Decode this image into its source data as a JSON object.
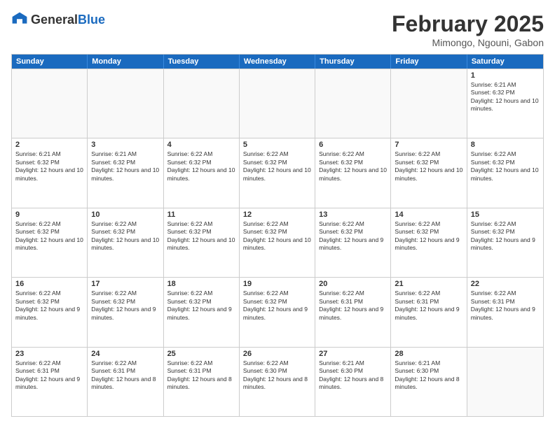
{
  "header": {
    "logo_general": "General",
    "logo_blue": "Blue",
    "month_title": "February 2025",
    "location": "Mimongo, Ngouni, Gabon"
  },
  "days_of_week": [
    "Sunday",
    "Monday",
    "Tuesday",
    "Wednesday",
    "Thursday",
    "Friday",
    "Saturday"
  ],
  "rows": [
    {
      "cells": [
        {
          "day": "",
          "empty": true
        },
        {
          "day": "",
          "empty": true
        },
        {
          "day": "",
          "empty": true
        },
        {
          "day": "",
          "empty": true
        },
        {
          "day": "",
          "empty": true
        },
        {
          "day": "",
          "empty": true
        },
        {
          "day": "1",
          "text": "Sunrise: 6:21 AM\nSunset: 6:32 PM\nDaylight: 12 hours and 10 minutes."
        }
      ]
    },
    {
      "cells": [
        {
          "day": "2",
          "text": "Sunrise: 6:21 AM\nSunset: 6:32 PM\nDaylight: 12 hours and 10 minutes."
        },
        {
          "day": "3",
          "text": "Sunrise: 6:21 AM\nSunset: 6:32 PM\nDaylight: 12 hours and 10 minutes."
        },
        {
          "day": "4",
          "text": "Sunrise: 6:22 AM\nSunset: 6:32 PM\nDaylight: 12 hours and 10 minutes."
        },
        {
          "day": "5",
          "text": "Sunrise: 6:22 AM\nSunset: 6:32 PM\nDaylight: 12 hours and 10 minutes."
        },
        {
          "day": "6",
          "text": "Sunrise: 6:22 AM\nSunset: 6:32 PM\nDaylight: 12 hours and 10 minutes."
        },
        {
          "day": "7",
          "text": "Sunrise: 6:22 AM\nSunset: 6:32 PM\nDaylight: 12 hours and 10 minutes."
        },
        {
          "day": "8",
          "text": "Sunrise: 6:22 AM\nSunset: 6:32 PM\nDaylight: 12 hours and 10 minutes."
        }
      ]
    },
    {
      "cells": [
        {
          "day": "9",
          "text": "Sunrise: 6:22 AM\nSunset: 6:32 PM\nDaylight: 12 hours and 10 minutes."
        },
        {
          "day": "10",
          "text": "Sunrise: 6:22 AM\nSunset: 6:32 PM\nDaylight: 12 hours and 10 minutes."
        },
        {
          "day": "11",
          "text": "Sunrise: 6:22 AM\nSunset: 6:32 PM\nDaylight: 12 hours and 10 minutes."
        },
        {
          "day": "12",
          "text": "Sunrise: 6:22 AM\nSunset: 6:32 PM\nDaylight: 12 hours and 10 minutes."
        },
        {
          "day": "13",
          "text": "Sunrise: 6:22 AM\nSunset: 6:32 PM\nDaylight: 12 hours and 9 minutes."
        },
        {
          "day": "14",
          "text": "Sunrise: 6:22 AM\nSunset: 6:32 PM\nDaylight: 12 hours and 9 minutes."
        },
        {
          "day": "15",
          "text": "Sunrise: 6:22 AM\nSunset: 6:32 PM\nDaylight: 12 hours and 9 minutes."
        }
      ]
    },
    {
      "cells": [
        {
          "day": "16",
          "text": "Sunrise: 6:22 AM\nSunset: 6:32 PM\nDaylight: 12 hours and 9 minutes."
        },
        {
          "day": "17",
          "text": "Sunrise: 6:22 AM\nSunset: 6:32 PM\nDaylight: 12 hours and 9 minutes."
        },
        {
          "day": "18",
          "text": "Sunrise: 6:22 AM\nSunset: 6:32 PM\nDaylight: 12 hours and 9 minutes."
        },
        {
          "day": "19",
          "text": "Sunrise: 6:22 AM\nSunset: 6:32 PM\nDaylight: 12 hours and 9 minutes."
        },
        {
          "day": "20",
          "text": "Sunrise: 6:22 AM\nSunset: 6:31 PM\nDaylight: 12 hours and 9 minutes."
        },
        {
          "day": "21",
          "text": "Sunrise: 6:22 AM\nSunset: 6:31 PM\nDaylight: 12 hours and 9 minutes."
        },
        {
          "day": "22",
          "text": "Sunrise: 6:22 AM\nSunset: 6:31 PM\nDaylight: 12 hours and 9 minutes."
        }
      ]
    },
    {
      "cells": [
        {
          "day": "23",
          "text": "Sunrise: 6:22 AM\nSunset: 6:31 PM\nDaylight: 12 hours and 9 minutes."
        },
        {
          "day": "24",
          "text": "Sunrise: 6:22 AM\nSunset: 6:31 PM\nDaylight: 12 hours and 8 minutes."
        },
        {
          "day": "25",
          "text": "Sunrise: 6:22 AM\nSunset: 6:31 PM\nDaylight: 12 hours and 8 minutes."
        },
        {
          "day": "26",
          "text": "Sunrise: 6:22 AM\nSunset: 6:30 PM\nDaylight: 12 hours and 8 minutes."
        },
        {
          "day": "27",
          "text": "Sunrise: 6:21 AM\nSunset: 6:30 PM\nDaylight: 12 hours and 8 minutes."
        },
        {
          "day": "28",
          "text": "Sunrise: 6:21 AM\nSunset: 6:30 PM\nDaylight: 12 hours and 8 minutes."
        },
        {
          "day": "",
          "empty": true
        }
      ]
    }
  ]
}
